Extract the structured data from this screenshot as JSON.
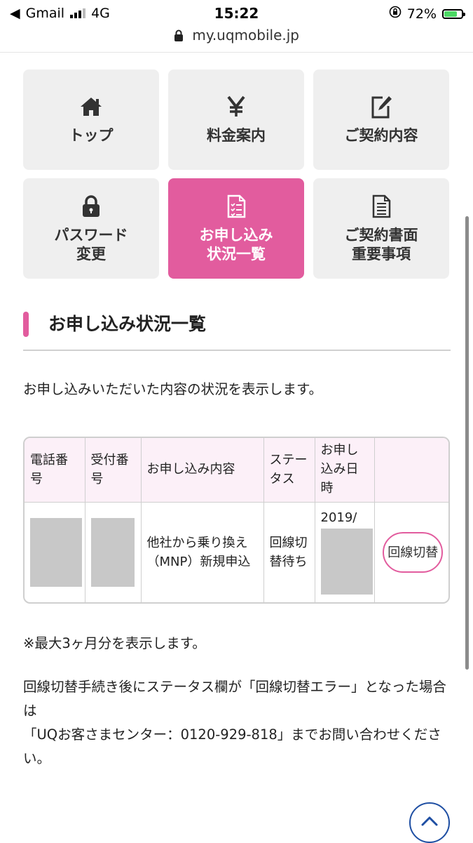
{
  "status_bar": {
    "carrier": "Gmail",
    "network": "4G",
    "time": "15:22",
    "battery": "72%"
  },
  "browser": {
    "url": "my.uqmobile.jp"
  },
  "menu": [
    {
      "label": "トップ",
      "icon": "home-icon",
      "active": false
    },
    {
      "label": "料金案内",
      "icon": "yen-icon",
      "active": false
    },
    {
      "label": "ご契約内容",
      "icon": "edit-icon",
      "active": false
    },
    {
      "label": "パスワード\n変更",
      "icon": "lock-icon",
      "active": false
    },
    {
      "label": "お申し込み\n状況一覧",
      "icon": "checklist-icon",
      "active": true
    },
    {
      "label": "ご契約書面\n重要事項",
      "icon": "document-icon",
      "active": false
    }
  ],
  "heading": "お申し込み状況一覧",
  "description": "お申し込みいただいた内容の状況を表示します。",
  "table": {
    "headers": [
      "電話番号",
      "受付番号",
      "お申し込み内容",
      "ステータス",
      "お申し込み日時",
      ""
    ],
    "rows": [
      {
        "phone": "",
        "reception": "",
        "content": "他社から乗り換え（MNP）新規申込",
        "status": "回線切替待ち",
        "date": "2019/",
        "action": "回線切替"
      }
    ]
  },
  "notes": {
    "note1": "※最大3ヶ月分を表示します。",
    "note2_line1": "回線切替手続き後にステータス欄が「回線切替エラー」となった場合は",
    "note2_line2": "「UQお客さまセンター：0120-929-818」までお問い合わせください。"
  },
  "colors": {
    "accent": "#e25c9e",
    "header_bg": "#fcf0f8",
    "tile_bg": "#efefef",
    "scroll_button": "#1f4fa3"
  }
}
